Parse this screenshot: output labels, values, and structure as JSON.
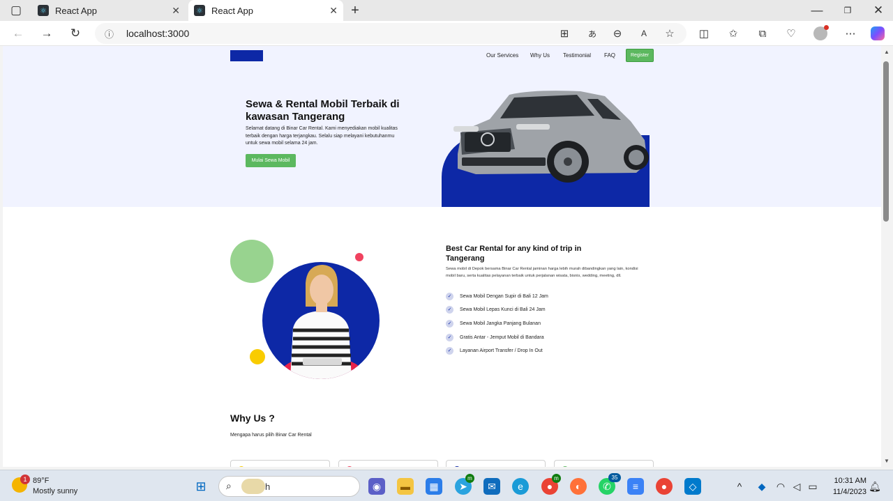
{
  "browser": {
    "tabs": [
      {
        "title": "React App"
      },
      {
        "title": "React App"
      }
    ],
    "url": "localhost:3000"
  },
  "page": {
    "nav": {
      "items": [
        "Our Services",
        "Why Us",
        "Testimonial",
        "FAQ"
      ],
      "register_label": "Register"
    },
    "hero": {
      "title": "Sewa & Rental Mobil Terbaik di kawasan Tangerang",
      "description": "Selamat datang di Binar Car Rental. Kami menyediakan mobil kualitas terbaik dengan harga terjangkau. Selalu siap melayani kebutuhanmu untuk sewa mobil selama 24 jam.",
      "cta_label": "Mulai Sewa Mobil"
    },
    "services": {
      "title": "Best Car Rental for any kind of trip in Tangerang",
      "description": "Sewa mobil di Depok bersama Binar Car Rental jaminan harga lebih murah dibandingkan yang lain, kondisi mobil baru, serta kualitas pelayanan terbaik untuk perjalanan wisata, bisnis, wedding, meeting, dll.",
      "items": [
        "Sewa Mobil Dengan Supir di Bali 12 Jam",
        "Sewa Mobil Lepas Kunci di Bali 24 Jam",
        "Sewa Mobil Jangka Panjang Bulanan",
        "Gratis Antar - Jemput Mobil di Bandara",
        "Layanan Airport Transfer / Drop In Out"
      ]
    },
    "why_us": {
      "title": "Why Us ?",
      "subtitle": "Mengapa harus pilih Binar Car Rental"
    }
  },
  "taskbar": {
    "weather_temp": "89°F",
    "weather_desc": "Mostly sunny",
    "weather_badge": "1",
    "search_placeholder": "Search",
    "telegram_badge": "m",
    "chrome_badge": "m",
    "whatsapp_badge": "35",
    "time": "10:31 AM",
    "date": "11/4/2023"
  }
}
